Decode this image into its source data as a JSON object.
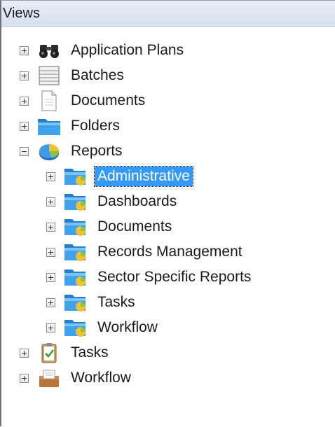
{
  "panel": {
    "title": "Views"
  },
  "tree": {
    "items": [
      {
        "label": "Application Plans",
        "icon": "binoculars-icon",
        "state": "collapsed"
      },
      {
        "label": "Batches",
        "icon": "batch-stack-icon",
        "state": "collapsed"
      },
      {
        "label": "Documents",
        "icon": "document-icon",
        "state": "collapsed"
      },
      {
        "label": "Folders",
        "icon": "folder-icon",
        "state": "collapsed"
      },
      {
        "label": "Reports",
        "icon": "pie-chart-icon",
        "state": "expanded",
        "children": [
          {
            "label": "Administrative",
            "icon": "report-folder-icon",
            "state": "collapsed",
            "selected": true
          },
          {
            "label": "Dashboards",
            "icon": "report-folder-icon",
            "state": "collapsed"
          },
          {
            "label": "Documents",
            "icon": "report-folder-icon",
            "state": "collapsed"
          },
          {
            "label": "Records Management",
            "icon": "report-folder-icon",
            "state": "collapsed"
          },
          {
            "label": "Sector Specific Reports",
            "icon": "report-folder-icon",
            "state": "collapsed"
          },
          {
            "label": "Tasks",
            "icon": "report-folder-icon",
            "state": "collapsed"
          },
          {
            "label": "Workflow",
            "icon": "report-folder-icon",
            "state": "collapsed"
          }
        ]
      },
      {
        "label": "Tasks",
        "icon": "task-clipboard-icon",
        "state": "collapsed"
      },
      {
        "label": "Workflow",
        "icon": "workflow-inbox-icon",
        "state": "collapsed"
      }
    ]
  },
  "colors": {
    "selection": "#3399ff",
    "header": "#dbe4f1"
  }
}
